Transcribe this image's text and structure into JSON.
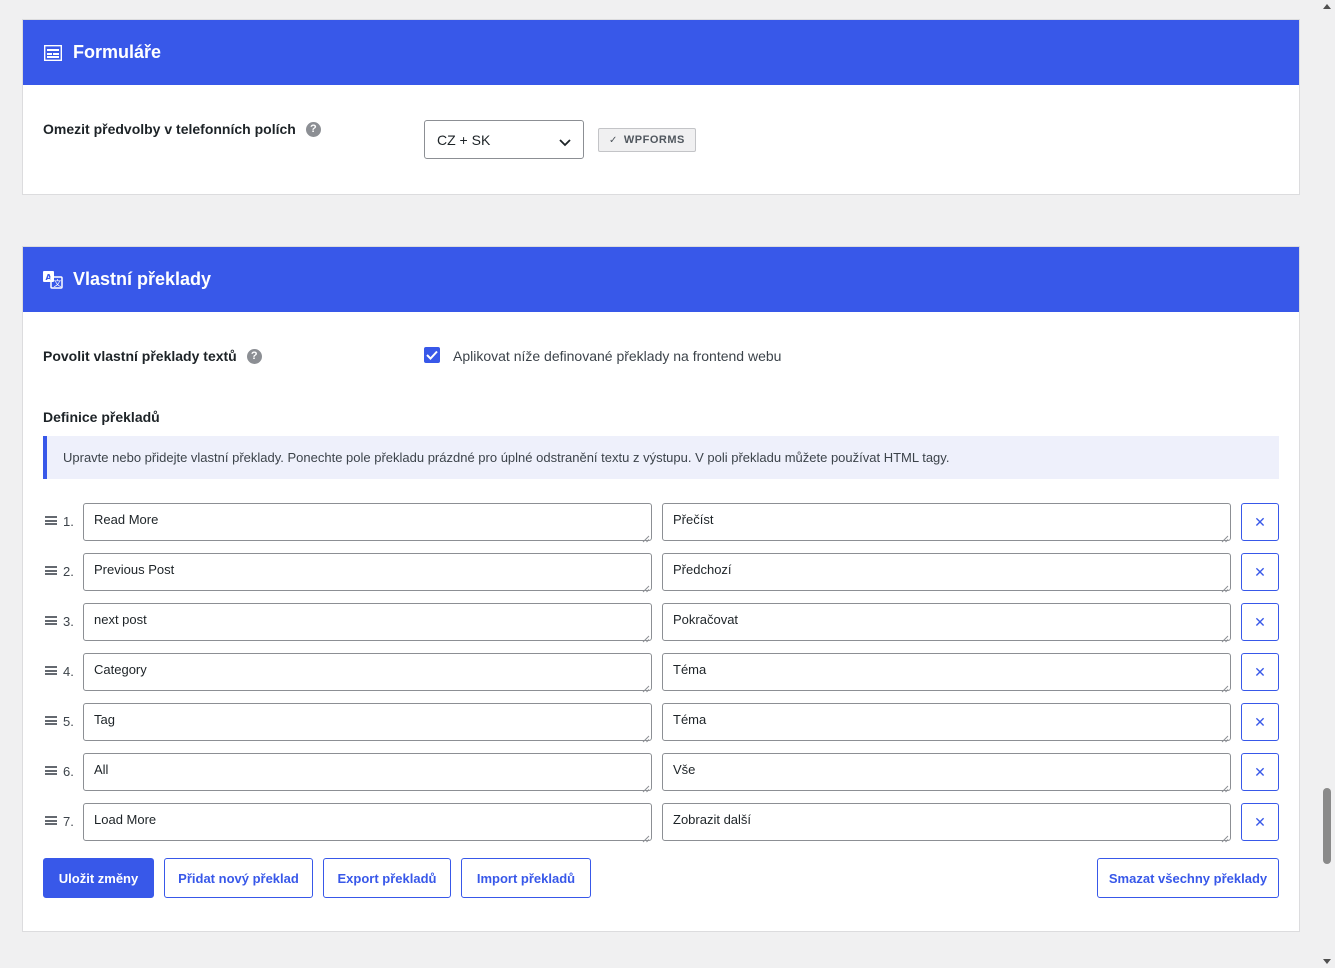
{
  "forms_section": {
    "title": "Formuláře",
    "icon": "form-icon",
    "phone_label": "Omezit předvolby v telefonních polích",
    "phone_select_value": "CZ + SK",
    "badge": "WPFORMS"
  },
  "translations_section": {
    "title": "Vlastní překlady",
    "icon": "translate-icon",
    "enable_label": "Povolit vlastní překlady textů",
    "enable_checked": true,
    "enable_checkbox_label": "Aplikovat níže definované překlady na frontend webu",
    "definitions_heading": "Definice překladů",
    "notice": "Upravte nebo přidejte vlastní překlady. Ponechte pole překladu prázdné pro úplné odstranění textu z výstupu. V poli překladu můžete používat HTML tagy.",
    "rows": [
      {
        "num": "1.",
        "source": "Read More",
        "translation": "Přečíst"
      },
      {
        "num": "2.",
        "source": "Previous Post",
        "translation": "Předchozí"
      },
      {
        "num": "3.",
        "source": "next post",
        "translation": "Pokračovat"
      },
      {
        "num": "4.",
        "source": "Category",
        "translation": "Téma"
      },
      {
        "num": "5.",
        "source": "Tag",
        "translation": "Téma"
      },
      {
        "num": "6.",
        "source": "All",
        "translation": "Vše"
      },
      {
        "num": "7.",
        "source": "Load More",
        "translation": "Zobrazit další"
      }
    ],
    "buttons": {
      "save": "Uložit změny",
      "add": "Přidat nový překlad",
      "export": "Export překladů",
      "import": "Import překladů",
      "delete_all": "Smazat všechny překlady"
    }
  },
  "colors": {
    "accent": "#3858e9",
    "background": "#f0f0f1",
    "notice_bg": "#eef0fb"
  }
}
